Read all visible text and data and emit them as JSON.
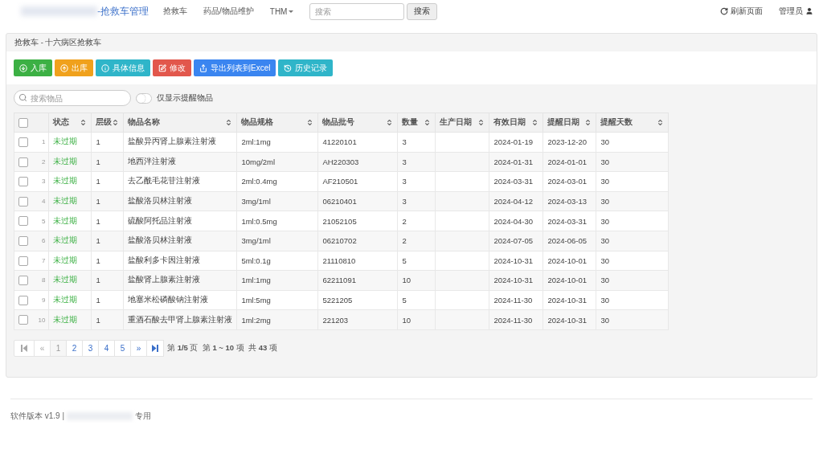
{
  "navbar": {
    "brand": "-抢救车管理",
    "links": [
      {
        "label": "抢救车",
        "dropdown": false
      },
      {
        "label": "药品/物品维护",
        "dropdown": false
      },
      {
        "label": "THM",
        "dropdown": true
      }
    ],
    "search": {
      "placeholder": "搜索",
      "button": "搜索"
    },
    "right": [
      {
        "kind": "refresh",
        "label": "刷新页面"
      },
      {
        "kind": "user",
        "label": "管理员"
      }
    ]
  },
  "panel": {
    "title": "抢救车 - 十六病区抢救车",
    "actions": [
      {
        "kind": "in",
        "label": "入库",
        "color": "#3cb044"
      },
      {
        "kind": "out",
        "label": "出库",
        "color": "#f0a11c"
      },
      {
        "kind": "info",
        "label": "具体信息",
        "color": "#2fb5c9"
      },
      {
        "kind": "edit",
        "label": "修改",
        "color": "#e2574c"
      },
      {
        "kind": "export",
        "label": "导出列表到Excel",
        "color": "#3a85f0"
      },
      {
        "kind": "history",
        "label": "历史记录",
        "color": "#2fb5c9"
      }
    ],
    "filter": {
      "placeholder": "搜索物品",
      "toggle_label": "仅显示提醒物品",
      "on": false
    },
    "table": {
      "header_checked": false,
      "columns": [
        "状态",
        "层级",
        "物品名称",
        "物品规格",
        "物品批号",
        "数量",
        "生产日期",
        "有效日期",
        "提醒日期",
        "提醒天数"
      ],
      "rows": [
        {
          "checked": false,
          "index": "1",
          "cells": [
            "未过期",
            "1",
            "盐酸异丙肾上腺素注射液",
            "2ml:1mg",
            "41220101",
            "3",
            "",
            "2024-01-19",
            "2023-12-20",
            "30"
          ]
        },
        {
          "checked": false,
          "index": "2",
          "cells": [
            "未过期",
            "1",
            "地西泮注射液",
            "10mg/2ml",
            "AH220303",
            "3",
            "",
            "2024-01-31",
            "2024-01-01",
            "30"
          ]
        },
        {
          "checked": false,
          "index": "3",
          "cells": [
            "未过期",
            "1",
            "去乙酰毛花苷注射液",
            "2ml:0.4mg",
            "AF210501",
            "3",
            "",
            "2024-03-31",
            "2024-03-01",
            "30"
          ]
        },
        {
          "checked": false,
          "index": "4",
          "cells": [
            "未过期",
            "1",
            "盐酸洛贝林注射液",
            "3mg/1ml",
            "06210401",
            "3",
            "",
            "2024-04-12",
            "2024-03-13",
            "30"
          ]
        },
        {
          "checked": false,
          "index": "5",
          "cells": [
            "未过期",
            "1",
            "硫酸阿托品注射液",
            "1ml:0.5mg",
            "21052105",
            "2",
            "",
            "2024-04-30",
            "2024-03-31",
            "30"
          ]
        },
        {
          "checked": false,
          "index": "6",
          "cells": [
            "未过期",
            "1",
            "盐酸洛贝林注射液",
            "3mg/1ml",
            "06210702",
            "2",
            "",
            "2024-07-05",
            "2024-06-05",
            "30"
          ]
        },
        {
          "checked": false,
          "index": "7",
          "cells": [
            "未过期",
            "1",
            "盐酸利多卡因注射液",
            "5ml:0.1g",
            "21110810",
            "5",
            "",
            "2024-10-31",
            "2024-10-01",
            "30"
          ]
        },
        {
          "checked": false,
          "index": "8",
          "cells": [
            "未过期",
            "1",
            "盐酸肾上腺素注射液",
            "1ml:1mg",
            "62211091",
            "10",
            "",
            "2024-10-31",
            "2024-10-01",
            "30"
          ]
        },
        {
          "checked": false,
          "index": "9",
          "cells": [
            "未过期",
            "1",
            "地塞米松磷酸钠注射液",
            "1ml:5mg",
            "5221205",
            "5",
            "",
            "2024-11-30",
            "2024-10-31",
            "30"
          ]
        },
        {
          "checked": false,
          "index": "10",
          "cells": [
            "未过期",
            "1",
            "重酒石酸去甲肾上腺素注射液",
            "1ml:2mg",
            "221203",
            "10",
            "",
            "2024-11-30",
            "2024-10-31",
            "30"
          ]
        }
      ]
    },
    "pagination": {
      "pages": [
        {
          "kind": "first",
          "disabled": true,
          "selected": false
        },
        {
          "kind": "prev",
          "label": "«",
          "disabled": true,
          "selected": false
        },
        {
          "kind": "page",
          "label": "1",
          "disabled": false,
          "selected": true
        },
        {
          "kind": "page",
          "label": "2",
          "disabled": false,
          "selected": false
        },
        {
          "kind": "page",
          "label": "3",
          "disabled": false,
          "selected": false
        },
        {
          "kind": "page",
          "label": "4",
          "disabled": false,
          "selected": false
        },
        {
          "kind": "page",
          "label": "5",
          "disabled": false,
          "selected": false
        },
        {
          "kind": "next",
          "label": "»",
          "disabled": false,
          "selected": false
        },
        {
          "kind": "last",
          "disabled": false,
          "selected": false
        }
      ],
      "summary": "第 **1/5** 页  第 **1 ~ 10** 项  共 **43** 项"
    }
  },
  "footer": {
    "version": "软件版本 v1.9 |",
    "suffix": "专用"
  }
}
